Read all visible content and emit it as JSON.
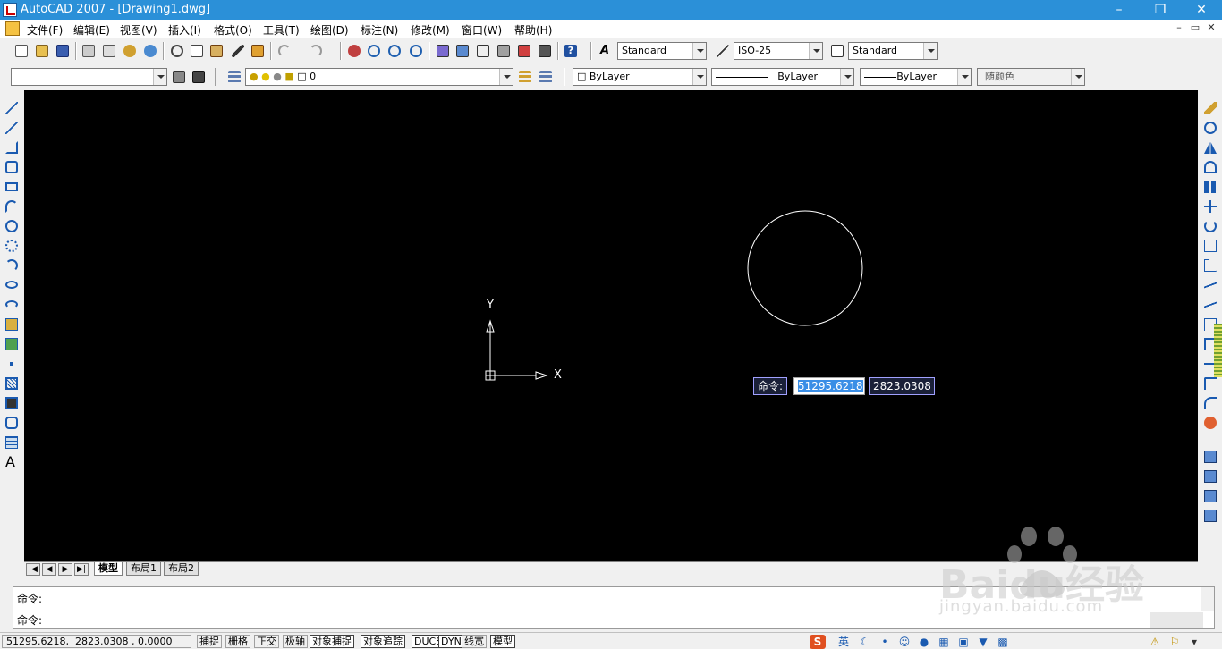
{
  "window": {
    "title": "AutoCAD 2007 - [Drawing1.dwg]",
    "minimize": "–",
    "restore": "❐",
    "close": "✕"
  },
  "menu": {
    "items": [
      "文件(F)",
      "编辑(E)",
      "视图(V)",
      "插入(I)",
      "格式(O)",
      "工具(T)",
      "绘图(D)",
      "标注(N)",
      "修改(M)",
      "窗口(W)",
      "帮助(H)"
    ],
    "mdi": {
      "minimize": "–",
      "restore": "▭",
      "close": "✕"
    }
  },
  "styles": {
    "text_style": "Standard",
    "dim_style": "ISO-25",
    "table_style": "Standard"
  },
  "layers": {
    "workspace": "",
    "current_layer": "0"
  },
  "properties": {
    "color": "ByLayer",
    "linetype": "ByLayer",
    "lineweight": "ByLayer",
    "plotstyle": "随颜色"
  },
  "drawing": {
    "ucs_x": "X",
    "ucs_y": "Y",
    "dynamic_input": {
      "label": "命令:",
      "x_value": "51295.6218",
      "y_value": "2823.0308"
    }
  },
  "layout_tabs": {
    "nav": [
      "|◀",
      "◀",
      "▶",
      "▶|"
    ],
    "tabs": [
      "模型",
      "布局1",
      "布局2"
    ]
  },
  "command": {
    "lines": [
      "命令:",
      "命令:"
    ]
  },
  "status": {
    "coords": "51295.6218,  2823.0308 , 0.0000",
    "toggles": [
      "捕捉",
      "栅格",
      "正交",
      "极轴",
      "对象捕捉",
      "对象追踪",
      "DUCS",
      "DYN",
      "线宽",
      "模型"
    ],
    "ime": [
      "S",
      "英"
    ]
  },
  "watermark": {
    "brand": "Baidu经验",
    "url": "jingyan.baidu.com"
  },
  "colors": {
    "title": "#2b90d8",
    "canvas": "#000000",
    "selection": "#3a8ee6"
  }
}
